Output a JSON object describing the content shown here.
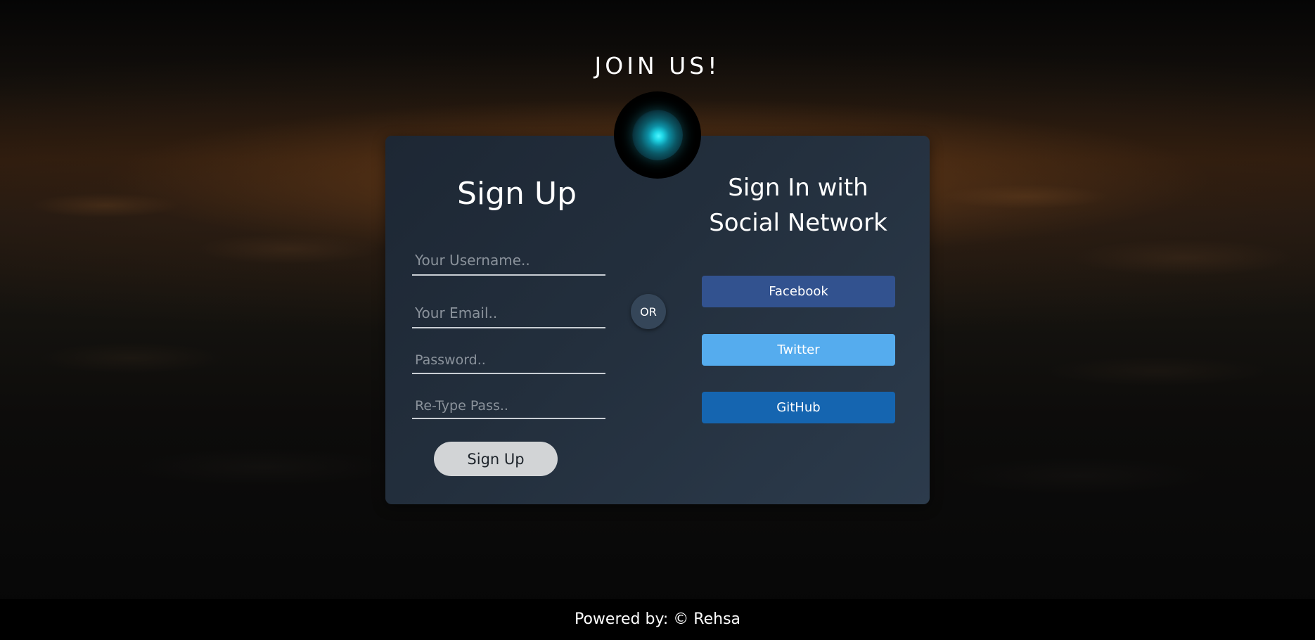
{
  "page": {
    "title": "JOIN US!"
  },
  "logo": {
    "icon": "glowing-orb-icon",
    "accent_color": "#33e6f5"
  },
  "signup": {
    "heading": "Sign Up",
    "fields": {
      "username_placeholder": "Your Username..",
      "email_placeholder": "Your Email..",
      "password_placeholder": "Password..",
      "retype_placeholder": "Re-Type Pass.."
    },
    "button_label": "Sign Up"
  },
  "divider": {
    "label": "OR"
  },
  "social": {
    "heading_line1": "Sign In with",
    "heading_line2": "Social Network",
    "buttons": [
      {
        "label": "Facebook",
        "color": "#32528f"
      },
      {
        "label": "Twitter",
        "color": "#55acee"
      },
      {
        "label": "GitHub",
        "color": "#1565b0"
      }
    ]
  },
  "footer": {
    "text": "Powered by: © Rehsa"
  }
}
